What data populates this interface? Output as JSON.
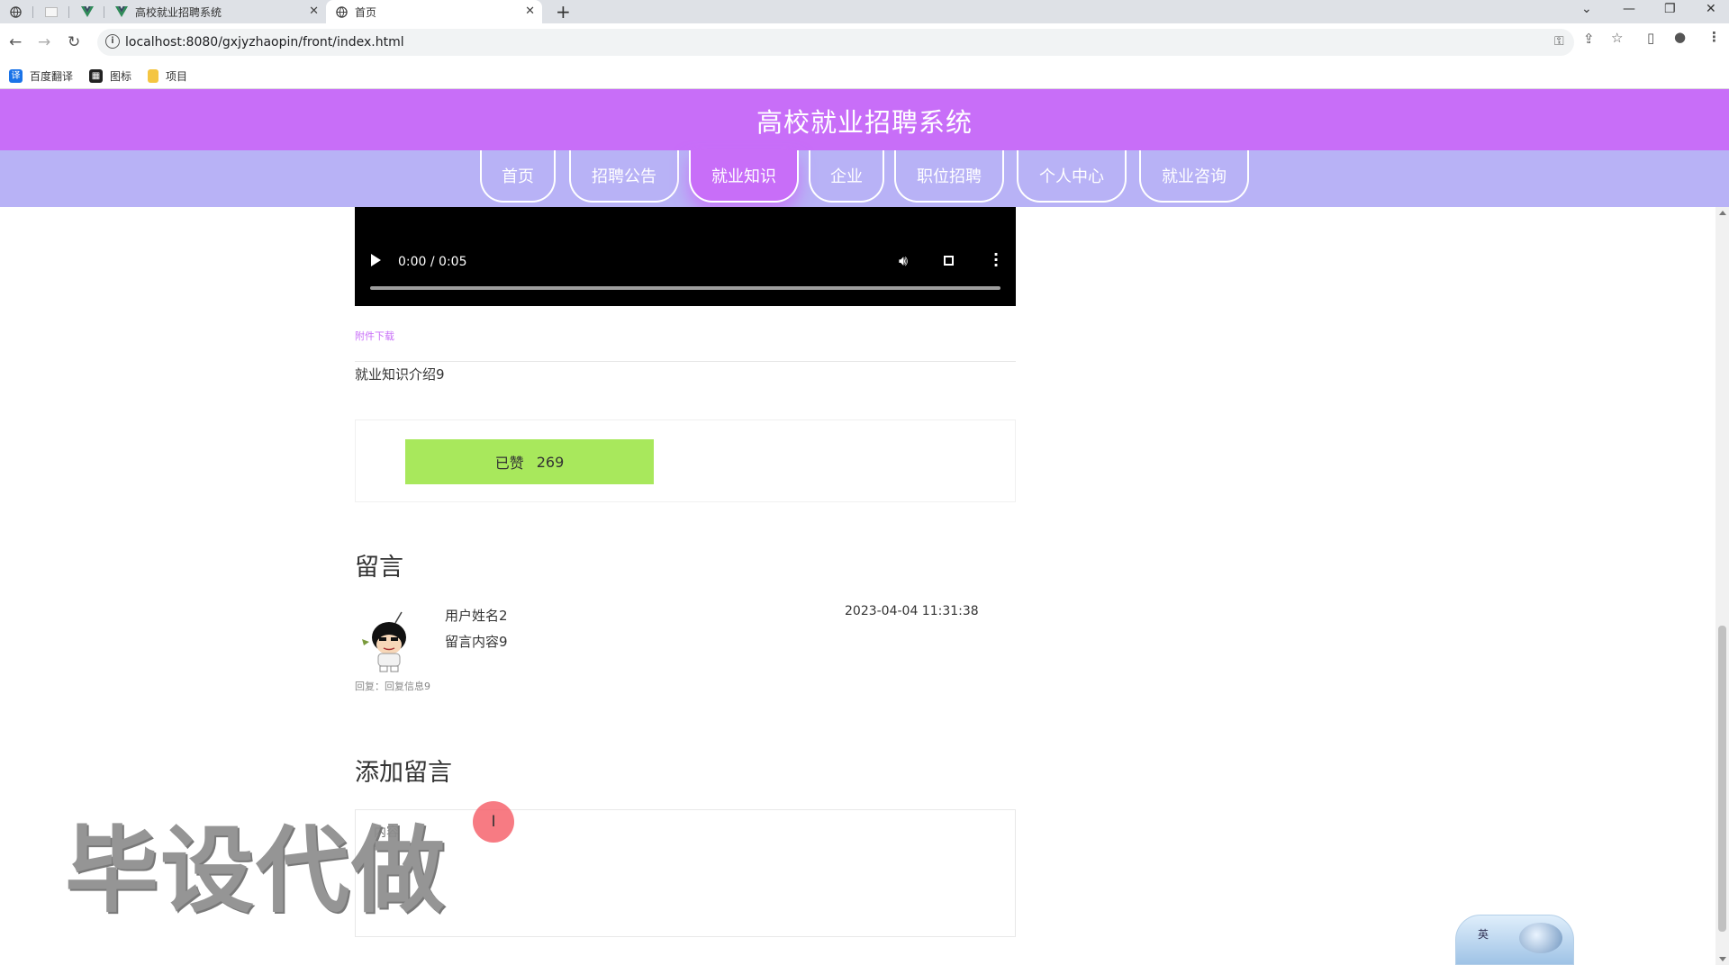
{
  "browser": {
    "tabs": [
      {
        "title": "",
        "icon": "globe-icon"
      },
      {
        "title": "",
        "icon": "blank-page-icon"
      },
      {
        "title": "",
        "icon": "vue-icon"
      },
      {
        "title": "高校就业招聘系统",
        "icon": "vue-icon"
      },
      {
        "title": "首页",
        "icon": "globe-icon",
        "active": true
      }
    ],
    "url": "localhost:8080/gxjyzhaopin/front/index.html",
    "bookmarks": [
      {
        "label": "百度翻译",
        "icon": "translate-icon"
      },
      {
        "label": "图标",
        "icon": "image-icon"
      },
      {
        "label": "项目",
        "icon": "folder-icon"
      }
    ]
  },
  "site": {
    "title": "高校就业招聘系统",
    "nav": [
      "首页",
      "招聘公告",
      "就业知识",
      "企业",
      "职位招聘",
      "个人中心",
      "就业咨询"
    ],
    "active_nav": "就业知识"
  },
  "video": {
    "time": "0:00 / 0:05"
  },
  "article": {
    "attachment_label": "附件下载",
    "intro": "就业知识介绍9",
    "like_label": "已赞",
    "like_count": "269"
  },
  "comments": {
    "heading": "留言",
    "items": [
      {
        "user": "用户姓名2",
        "text": "留言内容9",
        "time": "2023-04-04 11:31:38",
        "reply": "回复：回复信息9"
      }
    ]
  },
  "add_comment": {
    "heading": "添加留言",
    "placeholder": "内容"
  },
  "overlay": {
    "watermark": "毕设代做",
    "ime_label": "英"
  },
  "colors": {
    "header": "#c86ef8",
    "nav": "#b8b2f6",
    "like_button": "#a8e85c"
  }
}
